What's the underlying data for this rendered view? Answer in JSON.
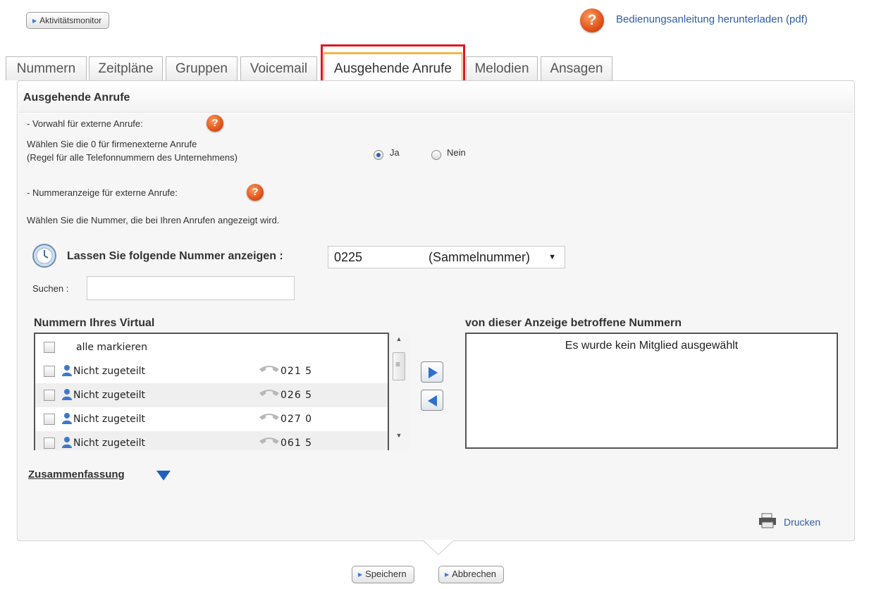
{
  "top": {
    "activity_button": "Aktivitätsmonitor",
    "help_link": "Bedienungsanleitung herunterladen (pdf)"
  },
  "tabs": [
    {
      "label": "Nummern"
    },
    {
      "label": "Zeitpläne"
    },
    {
      "label": "Gruppen"
    },
    {
      "label": "Voicemail"
    },
    {
      "label": "Ausgehende Anrufe",
      "active": true
    },
    {
      "label": "Melodien"
    },
    {
      "label": "Ansagen"
    }
  ],
  "panel": {
    "title": "Ausgehende Anrufe",
    "prefix_section": {
      "heading": "- Vorwahl für externe Anrufe:",
      "desc_line1": "Wählen Sie die 0 für firmenexterne Anrufe",
      "desc_line2": "(Regel für alle Telefonnummern des Unternehmens)",
      "option_yes": "Ja",
      "option_no": "Nein",
      "selected": "Ja"
    },
    "display_section": {
      "heading": "- Nummeranzeige für externe Anrufe:",
      "desc": "Wählen Sie die Nummer, die bei Ihren Anrufen angezeigt wird.",
      "display_label": "Lassen Sie folgende Nummer anzeigen :",
      "selected_number": "0225",
      "selected_suffix": "(Sammelnummer)"
    },
    "search_label": "Suchen :",
    "search_value": "",
    "left_list": {
      "title": "Nummern Ihres Virtual",
      "select_all": "alle markieren",
      "rows": [
        {
          "name": "Nicht zugeteilt",
          "number": "021 5"
        },
        {
          "name": "Nicht zugeteilt",
          "number": "026 5"
        },
        {
          "name": "Nicht zugeteilt",
          "number": "027 0"
        },
        {
          "name": "Nicht zugeteilt",
          "number": "061 5"
        }
      ]
    },
    "right_list": {
      "title": "von dieser Anzeige betroffene Nummern",
      "empty_message": "Es wurde kein Mitglied ausgewählt"
    },
    "summary_link": "Zusammenfassung",
    "print_link": "Drucken"
  },
  "footer": {
    "save_button": "Speichern",
    "cancel_button": "Abbrechen"
  },
  "colors": {
    "accent_blue": "#2f5fa8",
    "help_orange": "#e0531a",
    "highlight_red": "#e0171f"
  },
  "icons": {
    "help": "help-icon",
    "clock": "clock-icon",
    "person": "person-icon",
    "phone": "phone-icon",
    "printer": "printer-icon"
  }
}
